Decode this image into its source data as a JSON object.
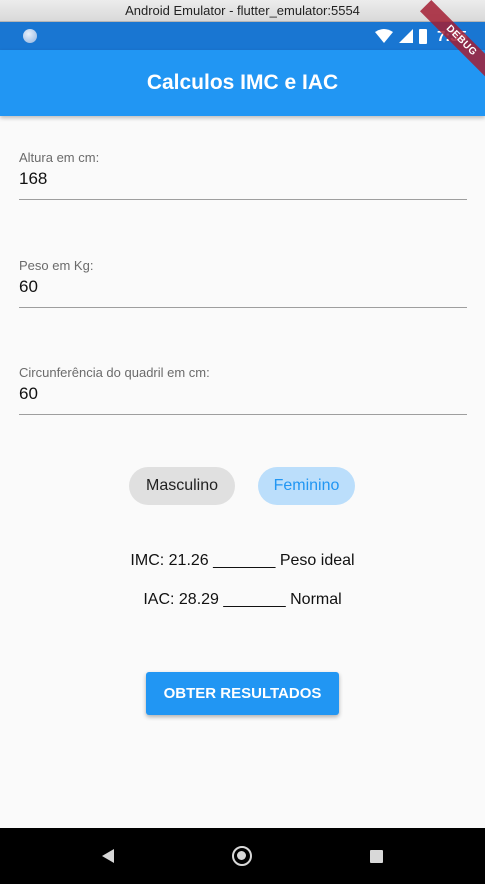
{
  "window": {
    "title": "Android Emulator - flutter_emulator:5554"
  },
  "status_bar": {
    "time": "7:35",
    "debug_label": "DEBUG"
  },
  "app_bar": {
    "title": "Calculos IMC e IAC"
  },
  "form": {
    "height": {
      "label": "Altura em cm:",
      "value": "168"
    },
    "weight": {
      "label": "Peso em Kg:",
      "value": "60"
    },
    "hip": {
      "label": "Circunferência do quadril em cm:",
      "value": "60"
    }
  },
  "gender": {
    "male_label": "Masculino",
    "female_label": "Feminino",
    "selected": "Feminino"
  },
  "results": {
    "imc": "IMC: 21.26 _______ Peso ideal",
    "iac": "IAC: 28.29 _______ Normal"
  },
  "actions": {
    "submit_label": "OBTER RESULTADOS"
  },
  "colors": {
    "primary": "#2196f3",
    "status_bar": "#1976d2",
    "chip_selected_bg": "#bbdefb",
    "chip_unselected_bg": "#e0e0e0",
    "debug_banner": "#a31e34"
  },
  "icons": {
    "status": [
      "app-indicator-icon",
      "wifi-icon",
      "signal-icon",
      "battery-icon"
    ],
    "navigation": [
      "back-icon",
      "home-icon",
      "recents-icon"
    ]
  }
}
